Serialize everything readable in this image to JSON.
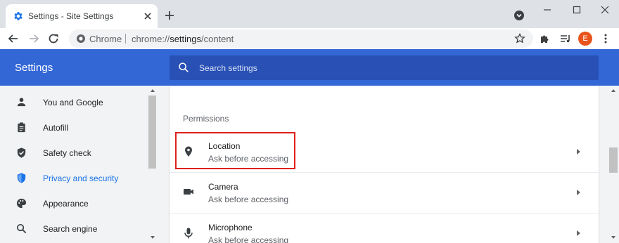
{
  "tab": {
    "title": "Settings - Site Settings"
  },
  "omnibox": {
    "site_chip": "Chrome",
    "url_scheme": "chrome://",
    "url_host": "settings",
    "url_path": "/content"
  },
  "profile": {
    "avatar_initial": "E",
    "avatar_color": "#e8541c"
  },
  "settings": {
    "title": "Settings",
    "search_placeholder": "Search settings",
    "header_color": "#3367d6"
  },
  "sidebar": {
    "items": [
      {
        "label": "You and Google",
        "icon": "person-icon"
      },
      {
        "label": "Autofill",
        "icon": "clipboard-icon"
      },
      {
        "label": "Safety check",
        "icon": "shield-check-icon"
      },
      {
        "label": "Privacy and security",
        "icon": "shield-icon",
        "active": true
      },
      {
        "label": "Appearance",
        "icon": "palette-icon"
      },
      {
        "label": "Search engine",
        "icon": "search-icon"
      }
    ]
  },
  "permissions": {
    "section_title": "Permissions",
    "items": [
      {
        "name": "Location",
        "status": "Ask before accessing",
        "icon": "location-pin-icon",
        "highlighted": true
      },
      {
        "name": "Camera",
        "status": "Ask before accessing",
        "icon": "camera-icon"
      },
      {
        "name": "Microphone",
        "status": "Ask before accessing",
        "icon": "microphone-icon"
      }
    ]
  },
  "colors": {
    "accent": "#1a73e8",
    "highlight_border": "#e0201b"
  }
}
